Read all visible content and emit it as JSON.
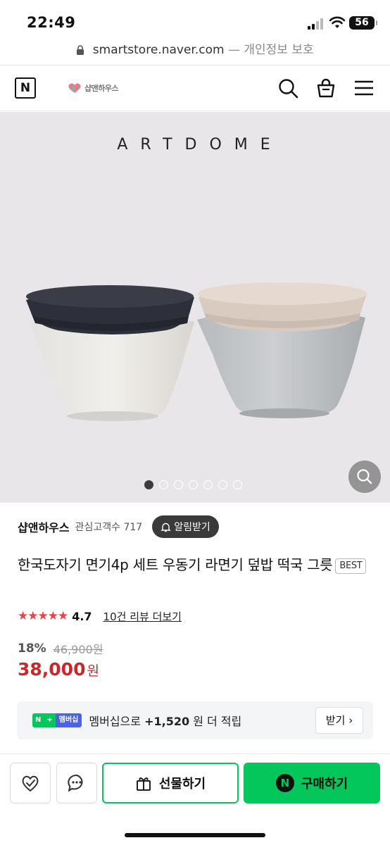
{
  "status_bar": {
    "time": "22:49",
    "battery": "56"
  },
  "url_bar": {
    "domain": "smartstore.naver.com",
    "suffix": "— 개인정보 보호"
  },
  "header": {
    "logo": "N",
    "brand_name": "샵앤하우스"
  },
  "hero": {
    "title": "ARTDOME",
    "slide_count": 7,
    "active_slide": 1
  },
  "store": {
    "name": "샵앤하우스",
    "fans": "관심고객수 717",
    "notify_label": "알림받기"
  },
  "product": {
    "title": "한국도자기 면기4p 세트 우동기 라면기 덮밥 떡국 그릇",
    "badge": "BEST",
    "stars": "★★★★★",
    "rating": "4.7",
    "review_link": "10건 리뷰 더보기",
    "discount": "18%",
    "original_price": "46,900원",
    "price": "38,000",
    "currency": "원"
  },
  "membership": {
    "badge_n": "N",
    "badge_plus": "+",
    "badge_label": "멤버십",
    "text_before": "멤버십으로",
    "points": "+1,520",
    "text_after": "원 더 적립",
    "button": "받기"
  },
  "bottom_bar": {
    "gift_label": "선물하기",
    "buy_label": "구매하기",
    "npay_logo": "N"
  },
  "colors": {
    "accent_green": "#03c75a",
    "price_red": "#c8282a",
    "star_red": "#e8434a",
    "hero_bg": "#e9e6ea"
  }
}
